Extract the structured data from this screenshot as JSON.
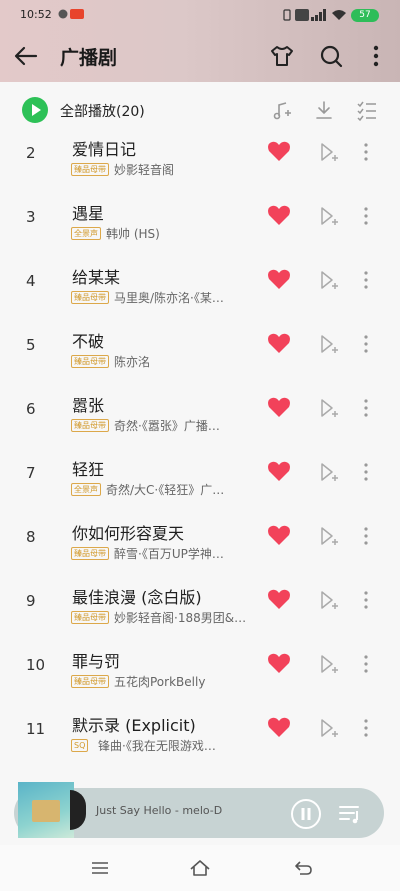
{
  "status": {
    "time": "10:52",
    "icons": [
      "signal-icon",
      "hd-icon",
      "5g-icon",
      "wifi-icon"
    ],
    "battery": "57"
  },
  "appbar": {
    "title": "广播剧"
  },
  "play_all": {
    "label": "全部播放(20)"
  },
  "songs": [
    {
      "num": "2",
      "title": "爱情日记",
      "badge": "臻品母带",
      "artist": "妙影轻音阁"
    },
    {
      "num": "3",
      "title": "遇星",
      "badge": "全景声",
      "artist": "韩帅 (HS)"
    },
    {
      "num": "4",
      "title": "给某某",
      "badge": "臻品母带",
      "artist": "马里奥/陈亦洺·《某…"
    },
    {
      "num": "5",
      "title": "不破",
      "badge": "臻品母带",
      "artist": "陈亦洺"
    },
    {
      "num": "6",
      "title": "嚣张",
      "badge": "臻品母带",
      "artist": "奇然·《嚣张》广播…"
    },
    {
      "num": "7",
      "title": "轻狂",
      "badge": "全景声",
      "artist": "奇然/大C·《轻狂》广…"
    },
    {
      "num": "8",
      "title": "你如何形容夏天",
      "badge": "臻品母带",
      "artist": "醉雪·《百万UP学神…"
    },
    {
      "num": "9",
      "title": "最佳浪漫 (念白版)",
      "badge": "臻品母带",
      "artist": "妙影轻音阁·188男团&…"
    },
    {
      "num": "10",
      "title": "罪与罚",
      "badge": "臻品母带",
      "artist": "五花肉PorkBelly"
    },
    {
      "num": "11",
      "title": "默示录 (Explicit)",
      "badge": "SQ",
      "artist": "锋曲·《我在无限游戏…"
    }
  ],
  "mini_player": {
    "now_playing": "Just Say Hello - melo-D"
  },
  "colors": {
    "accent_green": "#2dc157",
    "heart_red": "#f2425a",
    "badge_gold": "#d29a2c"
  }
}
